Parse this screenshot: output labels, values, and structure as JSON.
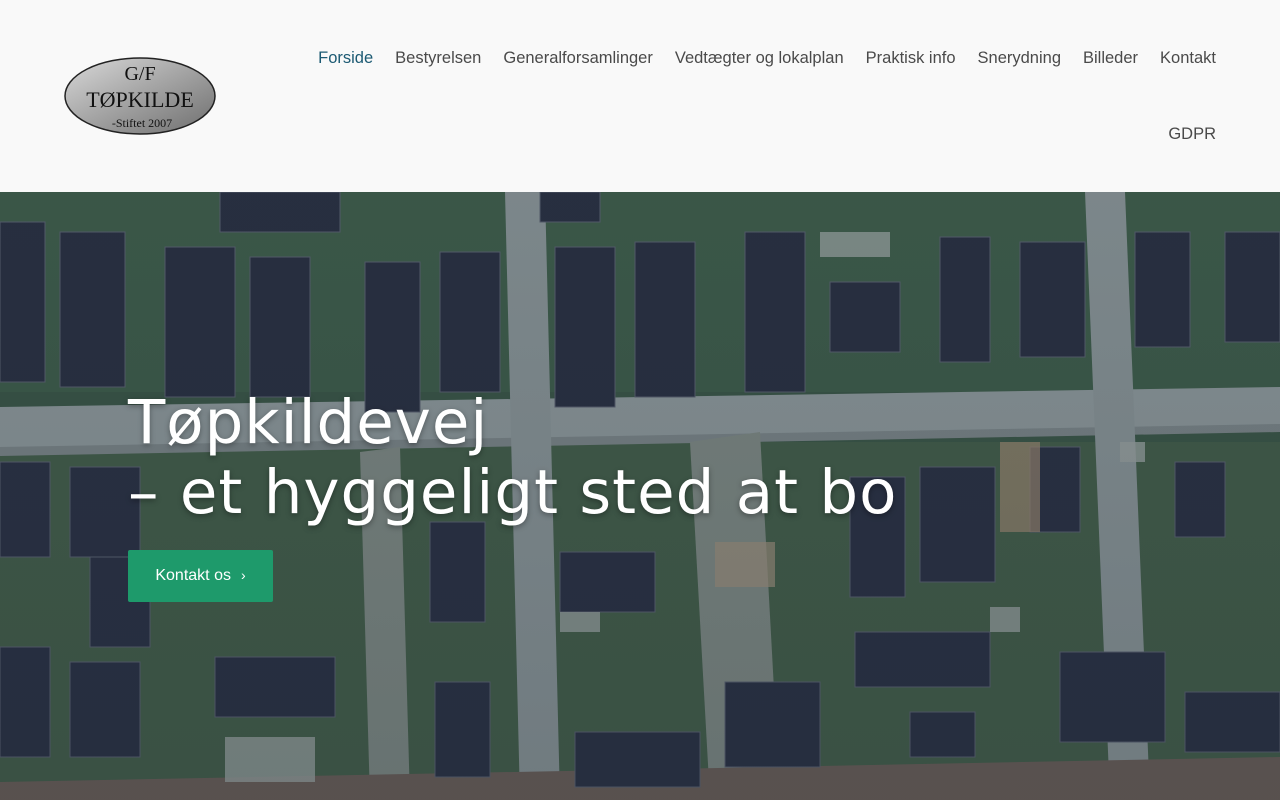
{
  "logo": {
    "line1": "G/F",
    "line2": "TØPKILDE",
    "line3": "-Stiftet 2007"
  },
  "nav": {
    "items": [
      {
        "label": "Forside",
        "active": true
      },
      {
        "label": "Bestyrelsen"
      },
      {
        "label": "Generalforsamlinger"
      },
      {
        "label": "Vedtægter og lokalplan"
      },
      {
        "label": "Praktisk info"
      },
      {
        "label": "Snerydning"
      },
      {
        "label": "Billeder"
      },
      {
        "label": "Kontakt"
      },
      {
        "label": "GDPR"
      }
    ]
  },
  "hero": {
    "title_line1": "Tøpkildevej",
    "title_line2": "– et hyggeligt sted at bo",
    "cta_label": "Kontakt os",
    "cta_icon": "chevron-right-icon"
  },
  "colors": {
    "accent": "#1e9a6b",
    "nav_active": "#1c5a73",
    "nav_text": "#4a4a4a",
    "header_bg": "#f9f9f9"
  }
}
